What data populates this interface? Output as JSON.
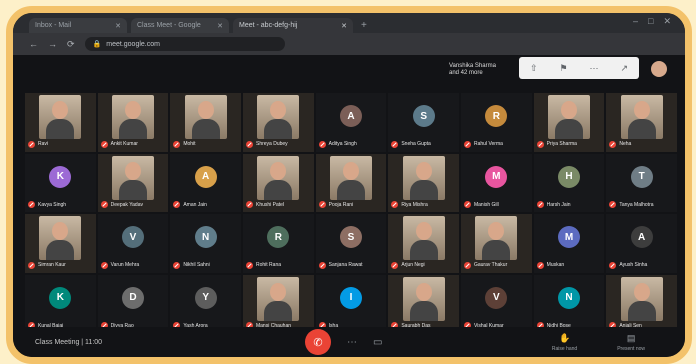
{
  "browser": {
    "tabs": [
      {
        "title": "Inbox - Mail",
        "active": false
      },
      {
        "title": "Class Meet - Google",
        "active": false
      },
      {
        "title": "Meet - abc-defg-hij",
        "active": true
      }
    ],
    "new_tab": "+",
    "window_controls": [
      "–",
      "□",
      "✕"
    ],
    "url": "meet.google.com"
  },
  "presenter": {
    "name_line1": "Vanshika Sharma",
    "name_line2": "and 42 more",
    "controls": [
      "⇧",
      "⚑",
      "⋯",
      "↗"
    ]
  },
  "participants": [
    {
      "name": "Ravi",
      "kind": "video"
    },
    {
      "name": "Ankit Kumar",
      "kind": "video"
    },
    {
      "name": "Mohit",
      "kind": "video"
    },
    {
      "name": "Shreya Dubey",
      "kind": "video"
    },
    {
      "name": "Aditya Singh",
      "kind": "avatar",
      "initial": "A",
      "color": "#7b5e57"
    },
    {
      "name": "Sneha Gupta",
      "kind": "avatar",
      "initial": "S",
      "color": "#5c7a8a"
    },
    {
      "name": "Rahul Verma",
      "kind": "avatar",
      "initial": "R",
      "color": "#c58a3c"
    },
    {
      "name": "Priya Sharma",
      "kind": "video"
    },
    {
      "name": "Neha",
      "kind": "video"
    },
    {
      "name": "Kavya Singh",
      "kind": "avatar",
      "initial": "K",
      "color": "#9c6ad5"
    },
    {
      "name": "Deepak Yadav",
      "kind": "video"
    },
    {
      "name": "Aman Jain",
      "kind": "avatar",
      "initial": "A",
      "color": "#d8a04a"
    },
    {
      "name": "Khushi Patel",
      "kind": "video"
    },
    {
      "name": "Pooja Rani",
      "kind": "video"
    },
    {
      "name": "Riya Mishra",
      "kind": "video"
    },
    {
      "name": "Manish Gill",
      "kind": "avatar",
      "initial": "M",
      "color": "#e8559f"
    },
    {
      "name": "Harsh Jain",
      "kind": "avatar",
      "initial": "H",
      "color": "#7a8a66"
    },
    {
      "name": "Tanya Malhotra",
      "kind": "avatar",
      "initial": "T",
      "color": "#6f7d86"
    },
    {
      "name": "Simran Kaur",
      "kind": "video"
    },
    {
      "name": "Varun Mehra",
      "kind": "avatar",
      "initial": "V",
      "color": "#546e7a"
    },
    {
      "name": "Nikhil Sahni",
      "kind": "avatar",
      "initial": "N",
      "color": "#607d8b"
    },
    {
      "name": "Rohit Rana",
      "kind": "avatar",
      "initial": "R",
      "color": "#4e6e5d"
    },
    {
      "name": "Sanjana Rawat",
      "kind": "avatar",
      "initial": "S",
      "color": "#8d6e63"
    },
    {
      "name": "Arjun Negi",
      "kind": "video"
    },
    {
      "name": "Gaurav Thakur",
      "kind": "video"
    },
    {
      "name": "Muskan",
      "kind": "avatar",
      "initial": "M",
      "color": "#5c6bc0"
    },
    {
      "name": "Ayush Sinha",
      "kind": "avatar",
      "initial": "A",
      "color": "#3d3d3d"
    },
    {
      "name": "Kunal Bajaj",
      "kind": "avatar",
      "initial": "K",
      "color": "#00897b"
    },
    {
      "name": "Divya Rao",
      "kind": "avatar",
      "initial": "D",
      "color": "#6d6d6d"
    },
    {
      "name": "Yash Arora",
      "kind": "avatar",
      "initial": "Y",
      "color": "#5d5d5d"
    },
    {
      "name": "Mansi Chauhan",
      "kind": "video"
    },
    {
      "name": "Isha",
      "kind": "avatar",
      "initial": "I",
      "color": "#039be5"
    },
    {
      "name": "Saurabh Das",
      "kind": "video"
    },
    {
      "name": "Vishal Kumar",
      "kind": "avatar",
      "initial": "V",
      "color": "#5d4037"
    },
    {
      "name": "Nidhi Bose",
      "kind": "avatar",
      "initial": "N",
      "color": "#0097a7"
    },
    {
      "name": "Anjali Sen",
      "kind": "video"
    }
  ],
  "bottom": {
    "meeting_info": "Class Meeting | 11:00",
    "controls": {
      "mic": "🎤",
      "end": "✆",
      "more": "⋯",
      "captions": "▭"
    },
    "right": [
      {
        "icon": "✋",
        "label": "Raise hand"
      },
      {
        "icon": "▤",
        "label": "Present now"
      }
    ]
  },
  "colors": {
    "frame": "#f3c26a",
    "background": "#fdf0c9",
    "end_call": "#ea4335"
  }
}
